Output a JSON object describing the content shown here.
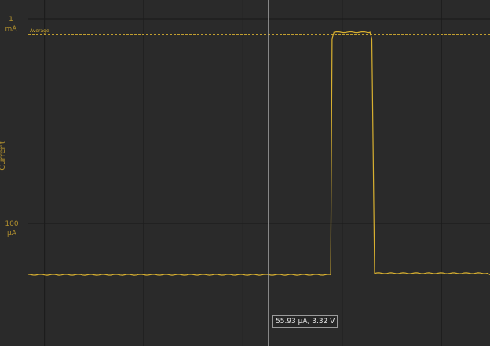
{
  "chart_data": {
    "type": "line",
    "title": "",
    "ylabel": "Current",
    "yscale": "log",
    "ylim_uA": [
      45,
      1000
    ],
    "yticks": [
      {
        "value_uA": 1000,
        "label": "1",
        "unit": "mA"
      },
      {
        "value_uA": 100,
        "label": "100",
        "unit": "µA"
      }
    ],
    "x_gridlines": [
      0.035,
      0.25,
      0.465,
      0.68,
      0.895
    ],
    "series": [
      {
        "name": "Current",
        "color": "#d8b030",
        "x": [
          0,
          0.655,
          0.658,
          0.662,
          0.74,
          0.744,
          0.75,
          1
        ],
        "values_uA": [
          56,
          56,
          800,
          860,
          860,
          800,
          57,
          56
        ]
      }
    ],
    "average": {
      "label": "Average",
      "value_uA": 840,
      "color": "#d8b030"
    },
    "cursor": {
      "x": 0.52,
      "tooltip": "55.93 µA, 3.32 V"
    }
  }
}
